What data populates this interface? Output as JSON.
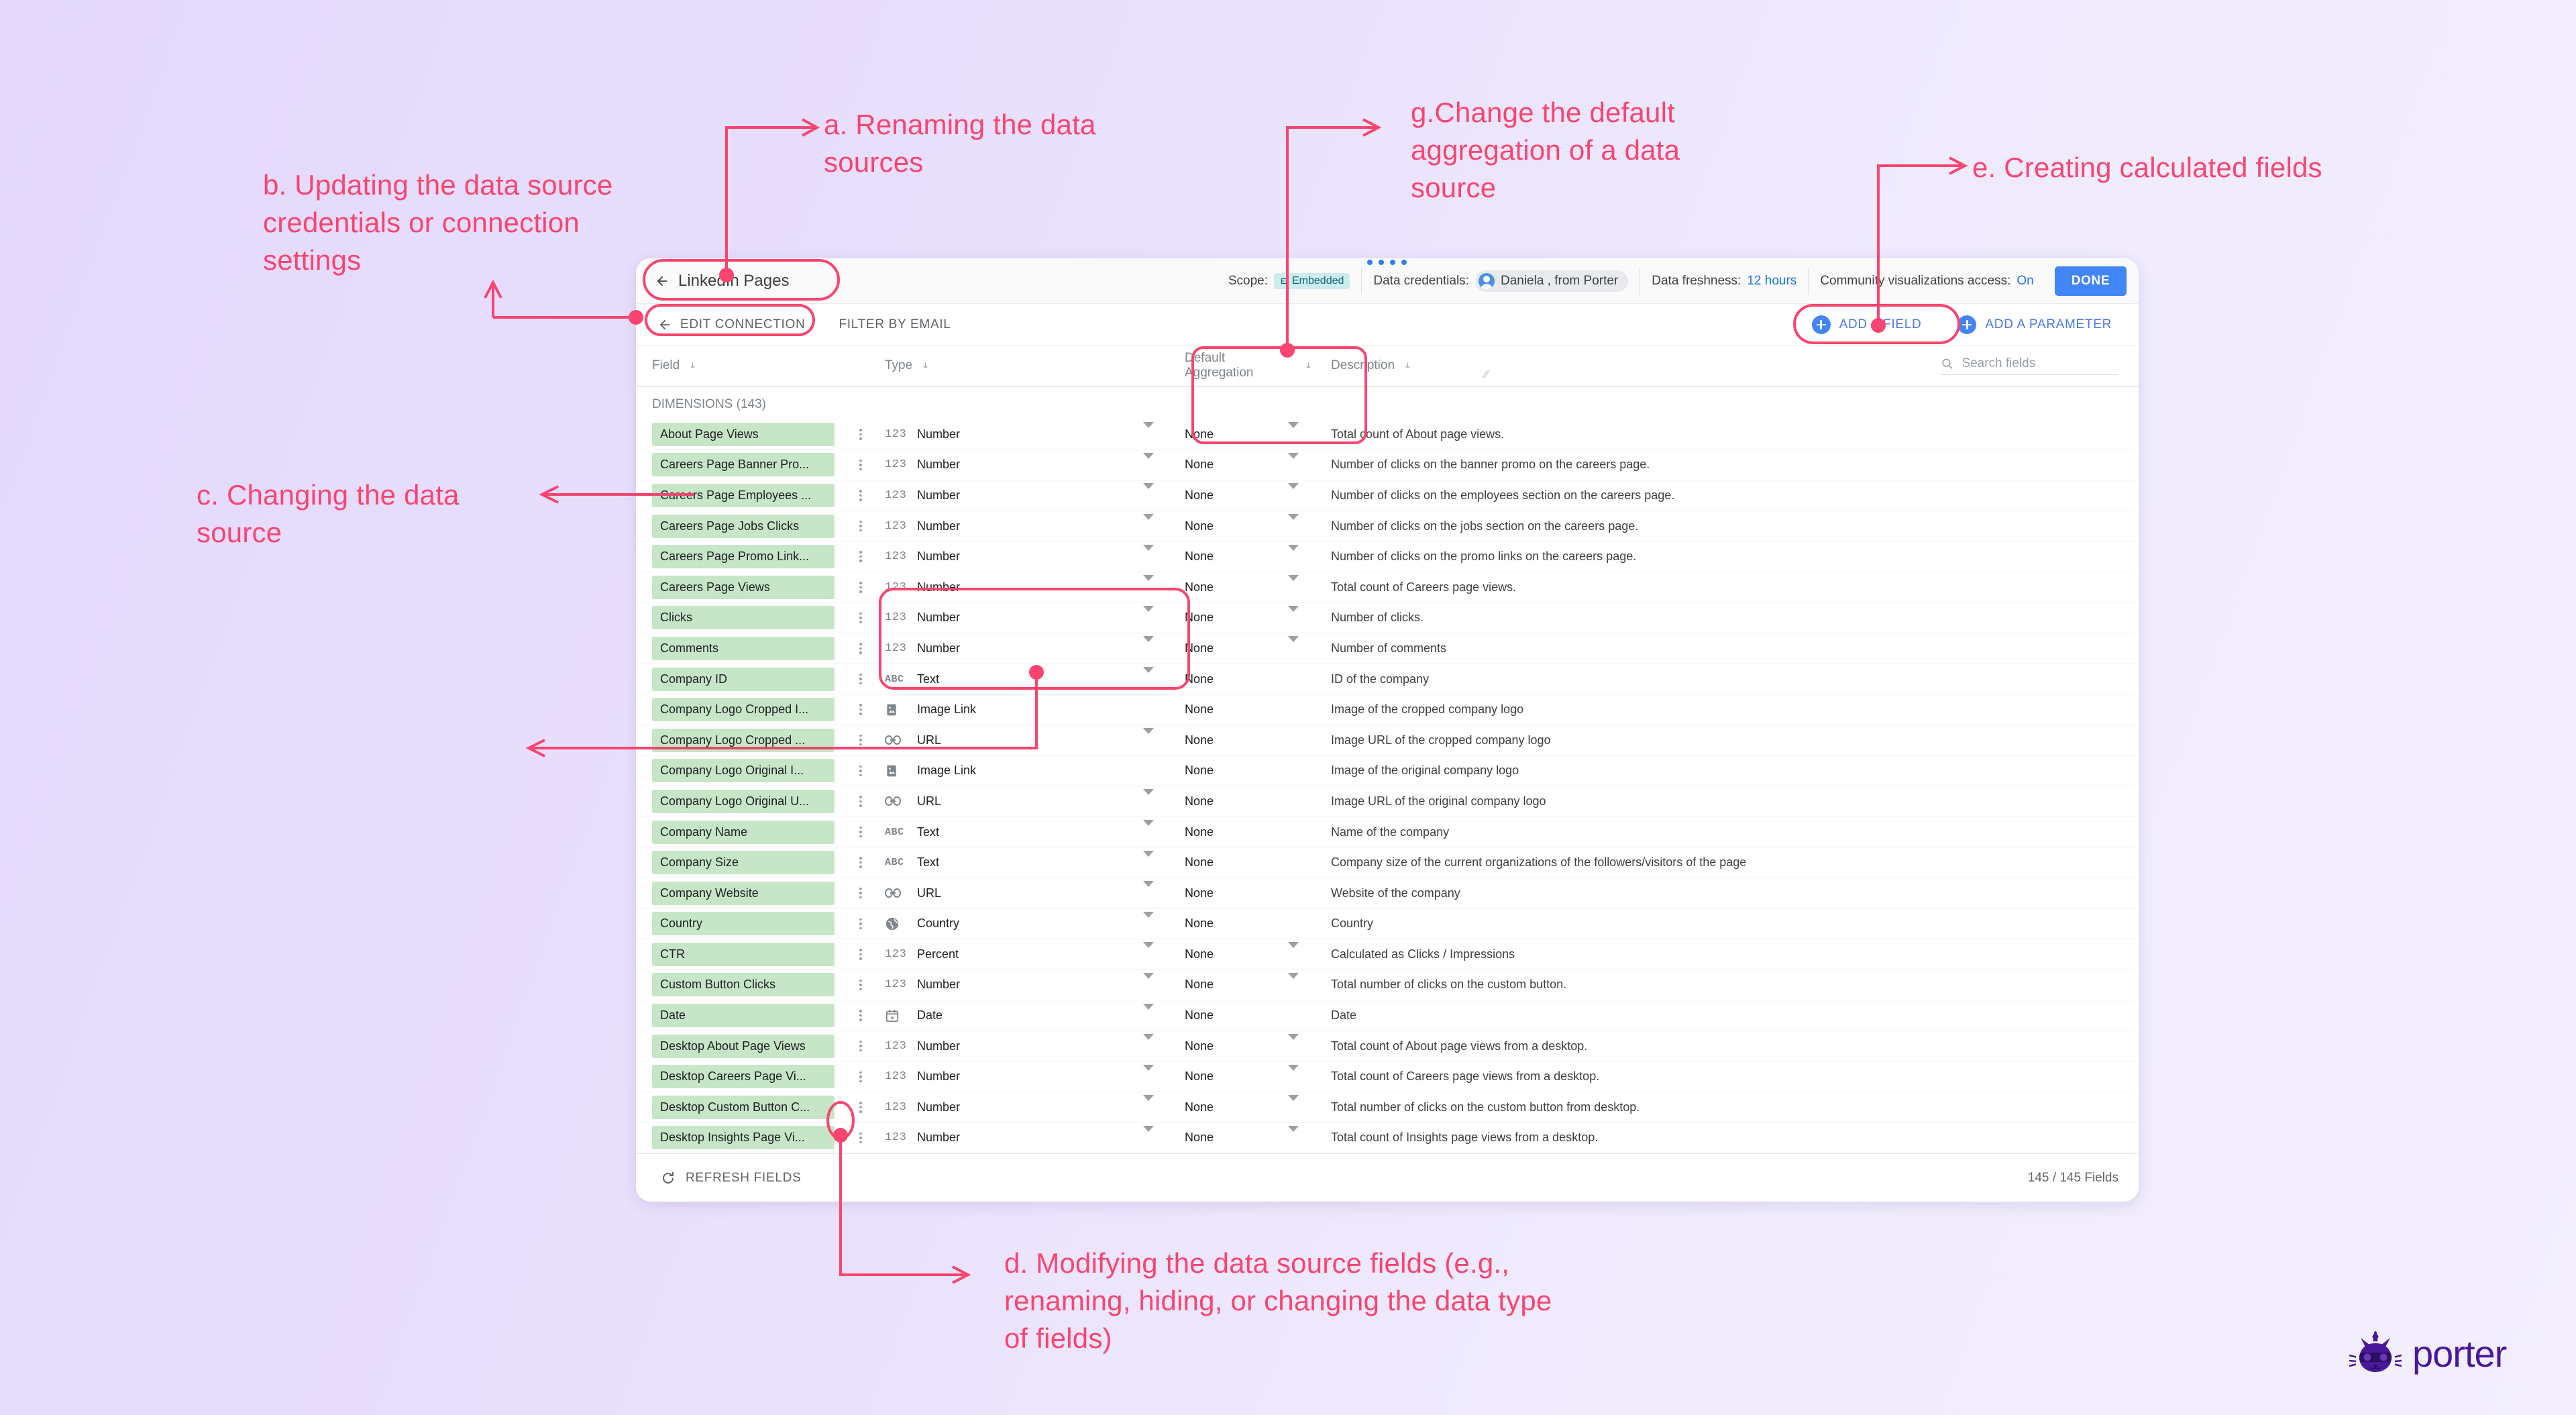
{
  "header": {
    "data_source_name": "LinkedIn Pages",
    "back_icon": "back-arrow-icon",
    "drag_handle_icon": "drag-handle-dots-icon",
    "scope_label": "Scope:",
    "scope_value": "Embedded",
    "scope_icon": "embedded-icon",
    "credentials_label": "Data credentials:",
    "credentials_value": "Daniela , from Porter",
    "credentials_avatar_icon": "user-avatar-icon",
    "freshness_label": "Data freshness:",
    "freshness_value": "12 hours",
    "community_label": "Community visualizations access:",
    "community_value": "On",
    "done_label": "DONE"
  },
  "toolbar": {
    "edit_connection_label": "EDIT CONNECTION",
    "edit_connection_icon": "back-arrow-icon",
    "filter_by_email_label": "FILTER BY EMAIL",
    "add_a_field_label": "ADD A FIELD",
    "add_a_parameter_label": "ADD A PARAMETER",
    "add_icon": "plus-circle-icon"
  },
  "table": {
    "columns": {
      "field": "Field",
      "type": "Type",
      "default_aggregation": "Default Aggregation",
      "description": "Description"
    },
    "sort_icon": "sort-down-arrow-icon",
    "search_placeholder": "Search fields",
    "search_value": "",
    "search_icon": "search-icon",
    "section_label": "DIMENSIONS (143)",
    "row_menu_icon": "kebab-menu-icon",
    "dropdown_caret_icon": "chevron-down-icon",
    "rows": [
      {
        "field": "About Page Views",
        "type": "Number",
        "type_icon": "number-123-icon",
        "aggregation": "None",
        "has_type_caret": true,
        "has_agg_caret": true,
        "description": "Total count of About page views."
      },
      {
        "field": "Careers Page Banner Pro...",
        "type": "Number",
        "type_icon": "number-123-icon",
        "aggregation": "None",
        "has_type_caret": true,
        "has_agg_caret": true,
        "description": "Number of clicks on the banner promo on the careers page."
      },
      {
        "field": "Careers Page Employees ...",
        "type": "Number",
        "type_icon": "number-123-icon",
        "aggregation": "None",
        "has_type_caret": true,
        "has_agg_caret": true,
        "description": "Number of clicks on the employees section on the careers page."
      },
      {
        "field": "Careers Page Jobs Clicks",
        "type": "Number",
        "type_icon": "number-123-icon",
        "aggregation": "None",
        "has_type_caret": true,
        "has_agg_caret": true,
        "description": "Number of clicks on the jobs section on the careers page."
      },
      {
        "field": "Careers Page Promo Link...",
        "type": "Number",
        "type_icon": "number-123-icon",
        "aggregation": "None",
        "has_type_caret": true,
        "has_agg_caret": true,
        "description": "Number of clicks on the promo links on the careers page."
      },
      {
        "field": "Careers Page Views",
        "type": "Number",
        "type_icon": "number-123-icon",
        "aggregation": "None",
        "has_type_caret": true,
        "has_agg_caret": true,
        "description": "Total count of Careers page views."
      },
      {
        "field": "Clicks",
        "type": "Number",
        "type_icon": "number-123-icon",
        "aggregation": "None",
        "has_type_caret": true,
        "has_agg_caret": true,
        "description": "Number of clicks."
      },
      {
        "field": "Comments",
        "type": "Number",
        "type_icon": "number-123-icon",
        "aggregation": "None",
        "has_type_caret": true,
        "has_agg_caret": true,
        "description": "Number of comments"
      },
      {
        "field": "Company ID",
        "type": "Text",
        "type_icon": "text-abc-icon",
        "aggregation": "None",
        "has_type_caret": true,
        "has_agg_caret": false,
        "description": "ID of the company"
      },
      {
        "field": "Company Logo Cropped I...",
        "type": "Image Link",
        "type_icon": "image-link-icon",
        "aggregation": "None",
        "has_type_caret": false,
        "has_agg_caret": false,
        "description": "Image of the cropped company logo"
      },
      {
        "field": "Company Logo Cropped ...",
        "type": "URL",
        "type_icon": "url-link-icon",
        "aggregation": "None",
        "has_type_caret": true,
        "has_agg_caret": false,
        "description": "Image URL of the cropped company logo"
      },
      {
        "field": "Company Logo Original I...",
        "type": "Image Link",
        "type_icon": "image-link-icon",
        "aggregation": "None",
        "has_type_caret": false,
        "has_agg_caret": false,
        "description": "Image of the original company logo"
      },
      {
        "field": "Company Logo Original U...",
        "type": "URL",
        "type_icon": "url-link-icon",
        "aggregation": "None",
        "has_type_caret": true,
        "has_agg_caret": false,
        "description": "Image URL of the original company logo"
      },
      {
        "field": "Company Name",
        "type": "Text",
        "type_icon": "text-abc-icon",
        "aggregation": "None",
        "has_type_caret": true,
        "has_agg_caret": false,
        "description": "Name of the company"
      },
      {
        "field": "Company Size",
        "type": "Text",
        "type_icon": "text-abc-icon",
        "aggregation": "None",
        "has_type_caret": true,
        "has_agg_caret": false,
        "description": "Company size of the current organizations of the followers/visitors of the page"
      },
      {
        "field": "Company Website",
        "type": "URL",
        "type_icon": "url-link-icon",
        "aggregation": "None",
        "has_type_caret": true,
        "has_agg_caret": false,
        "description": "Website of the company"
      },
      {
        "field": "Country",
        "type": "Country",
        "type_icon": "globe-country-icon",
        "aggregation": "None",
        "has_type_caret": true,
        "has_agg_caret": false,
        "description": "Country"
      },
      {
        "field": "CTR",
        "type": "Percent",
        "type_icon": "number-123-icon",
        "aggregation": "None",
        "has_type_caret": true,
        "has_agg_caret": true,
        "description": "Calculated as Clicks / Impressions"
      },
      {
        "field": "Custom Button Clicks",
        "type": "Number",
        "type_icon": "number-123-icon",
        "aggregation": "None",
        "has_type_caret": true,
        "has_agg_caret": true,
        "description": "Total number of clicks on the custom button."
      },
      {
        "field": "Date",
        "type": "Date",
        "type_icon": "calendar-date-icon",
        "aggregation": "None",
        "has_type_caret": true,
        "has_agg_caret": false,
        "description": "Date"
      },
      {
        "field": "Desktop About Page Views",
        "type": "Number",
        "type_icon": "number-123-icon",
        "aggregation": "None",
        "has_type_caret": true,
        "has_agg_caret": true,
        "description": "Total count of About page views from a desktop."
      },
      {
        "field": "Desktop Careers Page Vi...",
        "type": "Number",
        "type_icon": "number-123-icon",
        "aggregation": "None",
        "has_type_caret": true,
        "has_agg_caret": true,
        "description": "Total count of Careers page views from a desktop."
      },
      {
        "field": "Desktop Custom Button C...",
        "type": "Number",
        "type_icon": "number-123-icon",
        "aggregation": "None",
        "has_type_caret": true,
        "has_agg_caret": true,
        "description": "Total number of clicks on the custom button from desktop."
      },
      {
        "field": "Desktop Insights Page Vi...",
        "type": "Number",
        "type_icon": "number-123-icon",
        "aggregation": "None",
        "has_type_caret": true,
        "has_agg_caret": true,
        "description": "Total count of Insights page views from a desktop."
      }
    ]
  },
  "footer": {
    "refresh_label": "REFRESH FIELDS",
    "refresh_icon": "refresh-icon",
    "field_count": "145 / 145 Fields"
  },
  "annotations": {
    "a": "a. Renaming the data sources",
    "b": "b. Updating the data source credentials or connection settings",
    "c": "c. Changing the data source",
    "d": "d. Modifying the data source fields (e.g., renaming, hiding, or changing the data type of fields)",
    "e": "e. Creating calculated fields",
    "g": "g.Change the default aggregation of a data source",
    "accent_color": "#f9456f"
  },
  "brand": {
    "name": "porter",
    "logo_icon": "porter-cat-unicorn-logo-icon",
    "color": "#4a189b"
  }
}
